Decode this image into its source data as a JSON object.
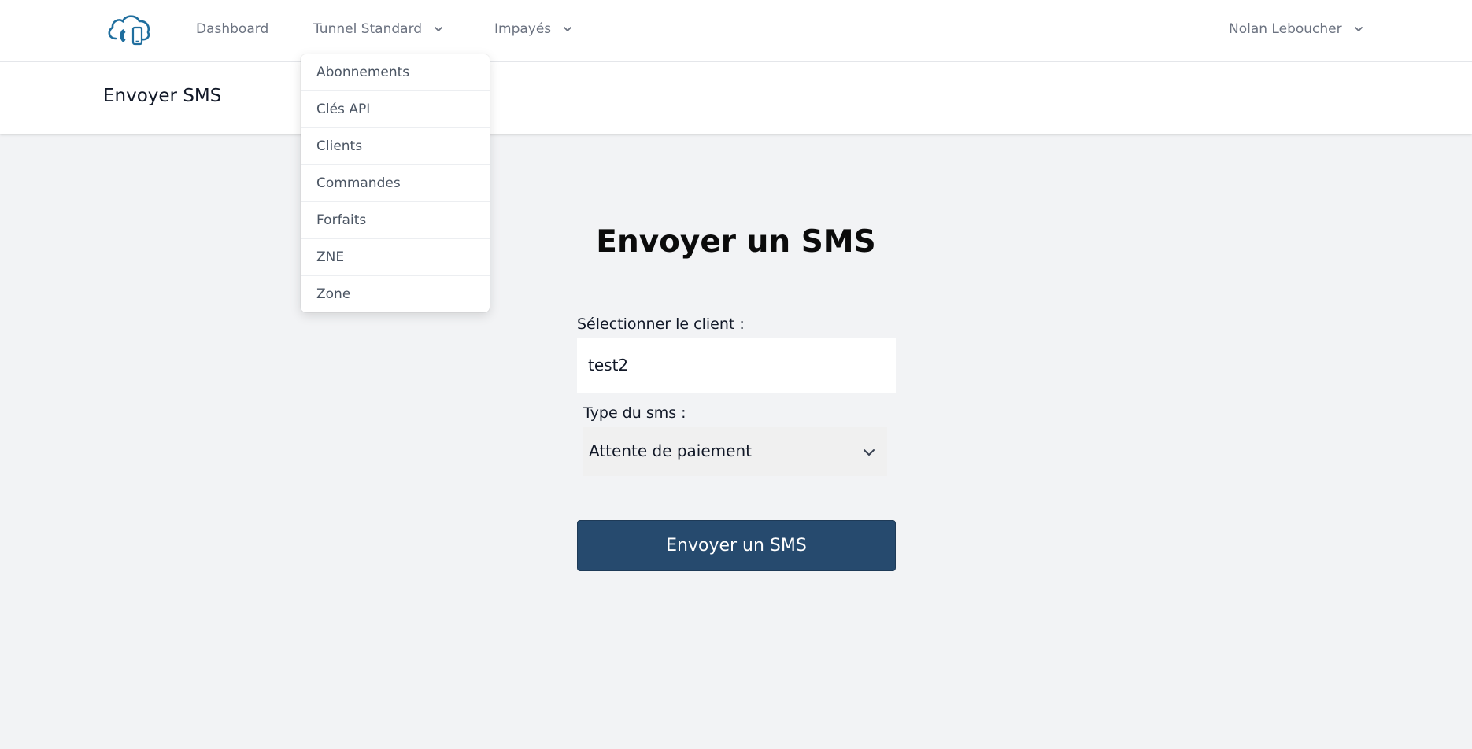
{
  "nav": {
    "links": [
      {
        "label": "Dashboard"
      },
      {
        "label": "Tunnel Standard"
      },
      {
        "label": "Impayés"
      }
    ],
    "user": "Nolan Leboucher"
  },
  "header": {
    "title": "Envoyer SMS"
  },
  "dropdown": {
    "items": [
      {
        "label": "Abonnements"
      },
      {
        "label": "Clés API"
      },
      {
        "label": "Clients"
      },
      {
        "label": "Commandes"
      },
      {
        "label": "Forfaits"
      },
      {
        "label": "ZNE"
      },
      {
        "label": "Zone"
      }
    ]
  },
  "form": {
    "title": "Envoyer un SMS",
    "client_label": "Sélectionner le client :",
    "client_value": "test2",
    "type_label": "Type du sms :",
    "type_value": "Attente de paiement",
    "submit_label": "Envoyer un SMS"
  },
  "colors": {
    "accent": "#264a6e",
    "logo": "#1f6e9e",
    "background": "#f2f3f5"
  },
  "icons": {
    "logo": "cloud-phone-icon",
    "chevron": "chevron-down-icon"
  }
}
